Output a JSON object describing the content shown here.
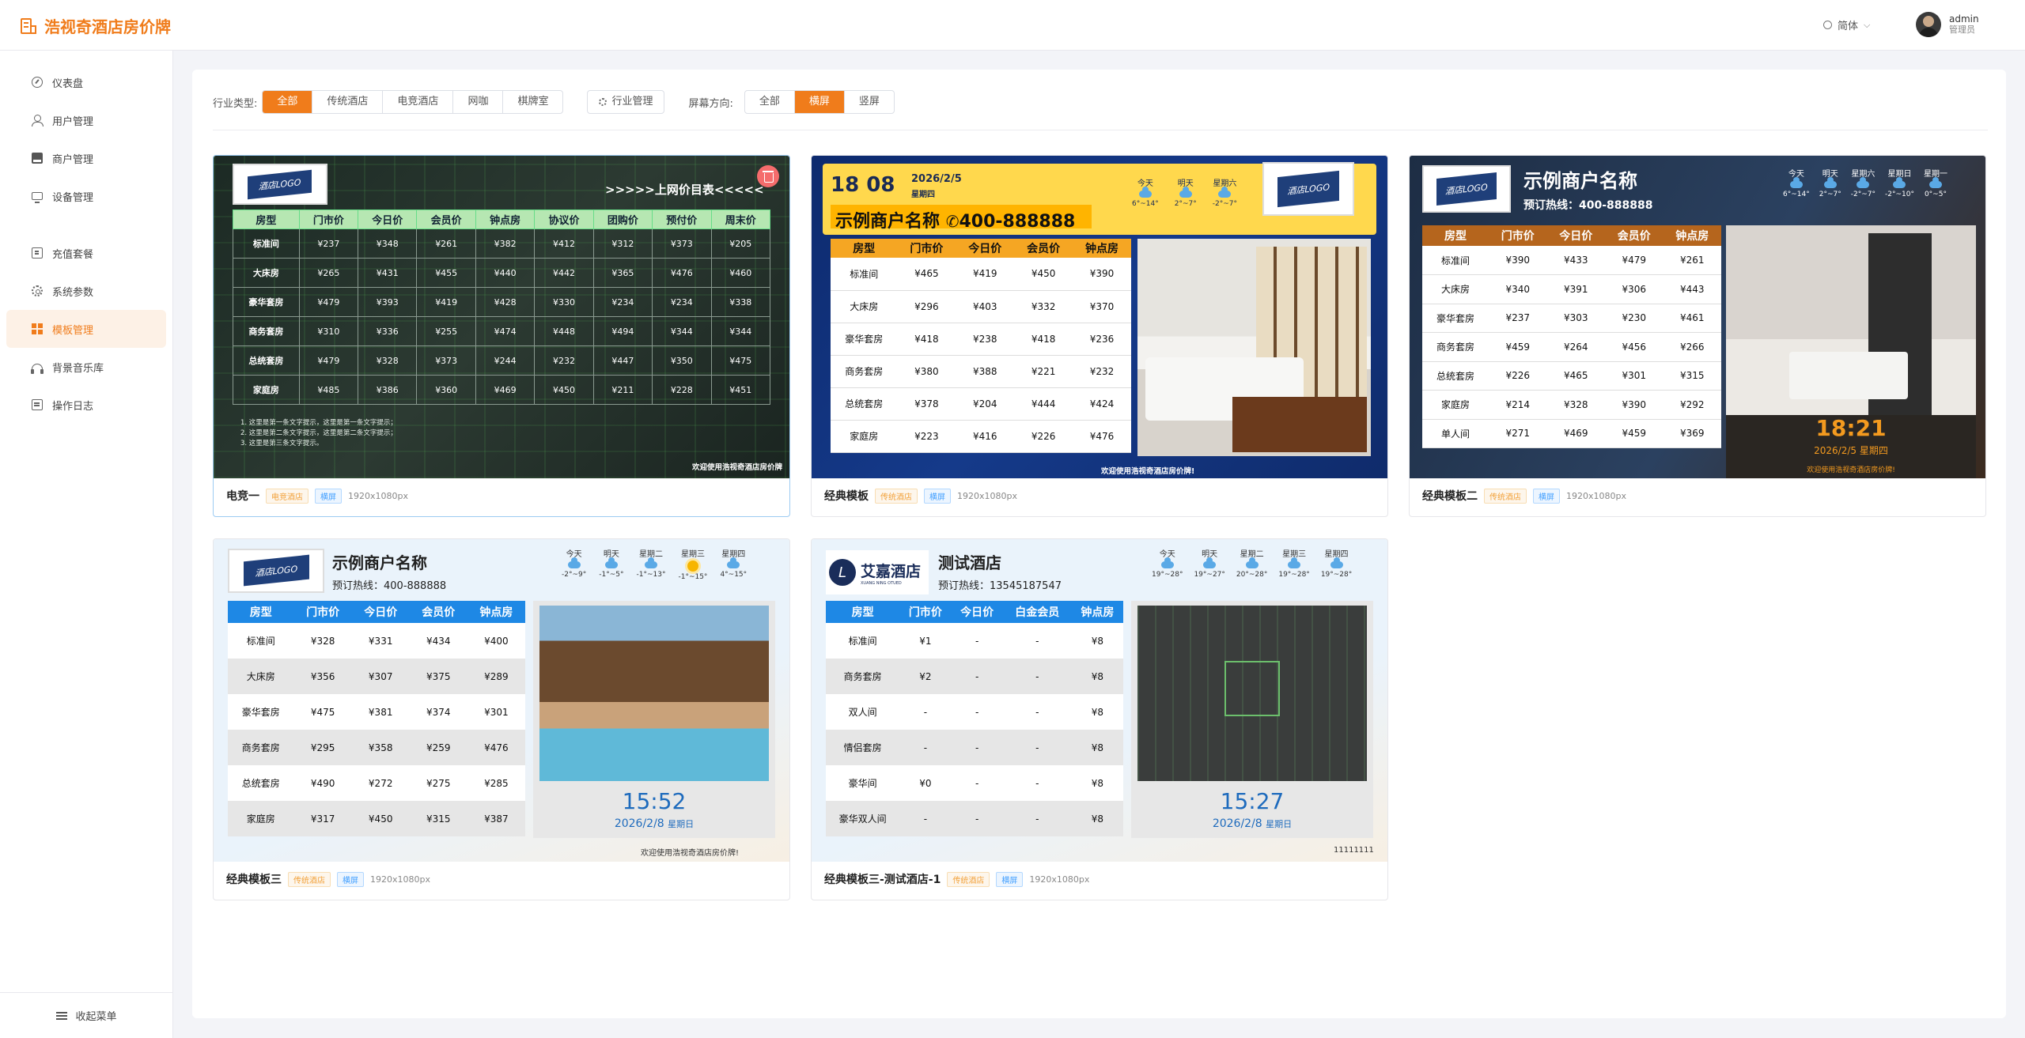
{
  "app": {
    "title": "浩视奇酒店房价牌",
    "lang": "简体",
    "user": {
      "name": "admin",
      "role": "管理员"
    }
  },
  "sidebar": {
    "items": [
      {
        "label": "仪表盘",
        "icon": "dashboard-icon"
      },
      {
        "label": "用户管理",
        "icon": "user-icon"
      },
      {
        "label": "商户管理",
        "icon": "shop-icon"
      },
      {
        "label": "设备管理",
        "icon": "monitor-icon"
      },
      {
        "label": "充值套餐",
        "icon": "package-icon"
      },
      {
        "label": "系统参数",
        "icon": "gear-icon"
      },
      {
        "label": "模板管理",
        "icon": "grid-icon",
        "active": true
      },
      {
        "label": "背景音乐库",
        "icon": "headphones-icon"
      },
      {
        "label": "操作日志",
        "icon": "log-icon"
      }
    ],
    "collapse": "收起菜单"
  },
  "filters": {
    "industry_label": "行业类型:",
    "industries": [
      "全部",
      "传统酒店",
      "电竞酒店",
      "网咖",
      "棋牌室"
    ],
    "industry_selected": "全部",
    "industry_manage": "行业管理",
    "orientation_label": "屏幕方向:",
    "orientations": [
      "全部",
      "横屏",
      "竖屏"
    ],
    "orientation_selected": "横屏"
  },
  "cards": [
    {
      "name": "电竞一",
      "tag": "电竞酒店",
      "orient": "横屏",
      "res": "1920x1080px",
      "board": {
        "title": ">>>>>上网价目表<<<<<",
        "headers": [
          "房型",
          "门市价",
          "今日价",
          "会员价",
          "钟点房",
          "协议价",
          "团购价",
          "预付价",
          "周末价"
        ],
        "rows": [
          [
            "标准间",
            "¥237",
            "¥348",
            "¥261",
            "¥382",
            "¥412",
            "¥312",
            "¥373",
            "¥205"
          ],
          [
            "大床房",
            "¥265",
            "¥431",
            "¥455",
            "¥440",
            "¥442",
            "¥365",
            "¥476",
            "¥460"
          ],
          [
            "豪华套房",
            "¥479",
            "¥393",
            "¥419",
            "¥428",
            "¥330",
            "¥234",
            "¥234",
            "¥338"
          ],
          [
            "商务套房",
            "¥310",
            "¥336",
            "¥255",
            "¥474",
            "¥448",
            "¥494",
            "¥344",
            "¥344"
          ],
          [
            "总统套房",
            "¥479",
            "¥328",
            "¥373",
            "¥244",
            "¥232",
            "¥447",
            "¥350",
            "¥475"
          ],
          [
            "家庭房",
            "¥485",
            "¥386",
            "¥360",
            "¥469",
            "¥450",
            "¥211",
            "¥228",
            "¥451"
          ]
        ],
        "notes": [
          "1. 这里是第一条文字提示，这里是第一条文字提示；",
          "2. 这里是第二条文字提示，这里是第二条文字提示；",
          "3. 这里是第三条文字提示。"
        ],
        "footer": "欢迎使用浩视奇酒店房价牌",
        "logo": "酒店LOGO"
      }
    },
    {
      "name": "经典模板",
      "tag": "传统酒店",
      "orient": "横屏",
      "res": "1920x1080px",
      "board": {
        "time": "18 08",
        "date": "2026/2/5",
        "weekday": "星期四",
        "merchant": "示例商户名称",
        "phone": "400-888888",
        "weather": [
          {
            "day": "今天",
            "temp": "6°~14°"
          },
          {
            "day": "明天",
            "temp": "2°~7°"
          },
          {
            "day": "星期六",
            "temp": "-2°~7°"
          }
        ],
        "headers": [
          "房型",
          "门市价",
          "今日价",
          "会员价",
          "钟点房"
        ],
        "rows": [
          [
            "标准间",
            "¥465",
            "¥419",
            "¥450",
            "¥390"
          ],
          [
            "大床房",
            "¥296",
            "¥403",
            "¥332",
            "¥370"
          ],
          [
            "豪华套房",
            "¥418",
            "¥238",
            "¥418",
            "¥236"
          ],
          [
            "商务套房",
            "¥380",
            "¥388",
            "¥221",
            "¥232"
          ],
          [
            "总统套房",
            "¥378",
            "¥204",
            "¥444",
            "¥424"
          ],
          [
            "家庭房",
            "¥223",
            "¥416",
            "¥226",
            "¥476"
          ]
        ],
        "footer": "欢迎使用浩视奇酒店房价牌!",
        "logo": "酒店LOGO"
      }
    },
    {
      "name": "经典模板二",
      "tag": "传统酒店",
      "orient": "横屏",
      "res": "1920x1080px",
      "board": {
        "merchant": "示例商户名称",
        "phone": "预订热线：400-888888",
        "weather": [
          {
            "day": "今天",
            "temp": "6°~14°"
          },
          {
            "day": "明天",
            "temp": "2°~7°"
          },
          {
            "day": "星期六",
            "temp": "-2°~7°"
          },
          {
            "day": "星期日",
            "temp": "-2°~10°"
          },
          {
            "day": "星期一",
            "temp": "0°~5°"
          }
        ],
        "headers": [
          "房型",
          "门市价",
          "今日价",
          "会员价",
          "钟点房"
        ],
        "rows": [
          [
            "标准间",
            "¥390",
            "¥433",
            "¥479",
            "¥261"
          ],
          [
            "大床房",
            "¥340",
            "¥391",
            "¥306",
            "¥443"
          ],
          [
            "豪华套房",
            "¥237",
            "¥303",
            "¥230",
            "¥461"
          ],
          [
            "商务套房",
            "¥459",
            "¥264",
            "¥456",
            "¥266"
          ],
          [
            "总统套房",
            "¥226",
            "¥465",
            "¥301",
            "¥315"
          ],
          [
            "家庭房",
            "¥214",
            "¥328",
            "¥390",
            "¥292"
          ],
          [
            "单人间",
            "¥271",
            "¥469",
            "¥459",
            "¥369"
          ]
        ],
        "time": "18:21",
        "date": "2026/2/5 星期四",
        "footer": "欢迎使用浩视奇酒店房价牌!",
        "logo": "酒店LOGO"
      }
    },
    {
      "name": "经典模板三",
      "tag": "传统酒店",
      "orient": "横屏",
      "res": "1920x1080px",
      "board": {
        "merchant": "示例商户名称",
        "phone": "预订热线：400-888888",
        "weather": [
          {
            "day": "今天",
            "temp": "-2°~9°",
            "i": "c"
          },
          {
            "day": "明天",
            "temp": "-1°~5°",
            "i": "c"
          },
          {
            "day": "星期二",
            "temp": "-1°~13°",
            "i": "c"
          },
          {
            "day": "星期三",
            "temp": "-1°~15°",
            "i": "s"
          },
          {
            "day": "星期四",
            "temp": "4°~15°",
            "i": "c"
          }
        ],
        "headers": [
          "房型",
          "门市价",
          "今日价",
          "会员价",
          "钟点房"
        ],
        "rows": [
          [
            "标准间",
            "¥328",
            "¥331",
            "¥434",
            "¥400"
          ],
          [
            "大床房",
            "¥356",
            "¥307",
            "¥375",
            "¥289"
          ],
          [
            "豪华套房",
            "¥475",
            "¥381",
            "¥374",
            "¥301"
          ],
          [
            "商务套房",
            "¥295",
            "¥358",
            "¥259",
            "¥476"
          ],
          [
            "总统套房",
            "¥490",
            "¥272",
            "¥275",
            "¥285"
          ],
          [
            "家庭房",
            "¥317",
            "¥450",
            "¥315",
            "¥387"
          ]
        ],
        "time": "15:52",
        "date": "2026/2/8",
        "weekday": "星期日",
        "footer": "欢迎使用浩视奇酒店房价牌!",
        "logo": "酒店LOGO"
      }
    },
    {
      "name": "经典模板三-测试酒店-1",
      "tag": "传统酒店",
      "orient": "横屏",
      "res": "1920x1080px",
      "board": {
        "merchant": "测试酒店",
        "phone": "预订热线：13545187547",
        "brand": "艾嘉酒店",
        "brand_en": "XUANG NING OTUED",
        "weather": [
          {
            "day": "今天",
            "temp": "19°~28°"
          },
          {
            "day": "明天",
            "temp": "19°~27°"
          },
          {
            "day": "星期二",
            "temp": "20°~28°"
          },
          {
            "day": "星期三",
            "temp": "19°~28°"
          },
          {
            "day": "星期四",
            "temp": "19°~28°"
          }
        ],
        "headers": [
          "房型",
          "门市价",
          "今日价",
          "白金会员",
          "钟点房"
        ],
        "rows": [
          [
            "标准间",
            "¥1",
            "-",
            "-",
            "¥8"
          ],
          [
            "商务套房",
            "¥2",
            "-",
            "-",
            "¥8"
          ],
          [
            "双人间",
            "-",
            "-",
            "-",
            "¥8"
          ],
          [
            "情侣套房",
            "-",
            "-",
            "-",
            "¥8"
          ],
          [
            "豪华间",
            "¥0",
            "-",
            "-",
            "¥8"
          ],
          [
            "豪华双人间",
            "-",
            "-",
            "-",
            "¥8"
          ]
        ],
        "time": "15:27",
        "date": "2026/2/8",
        "weekday": "星期日",
        "footer": "11111111"
      }
    }
  ]
}
